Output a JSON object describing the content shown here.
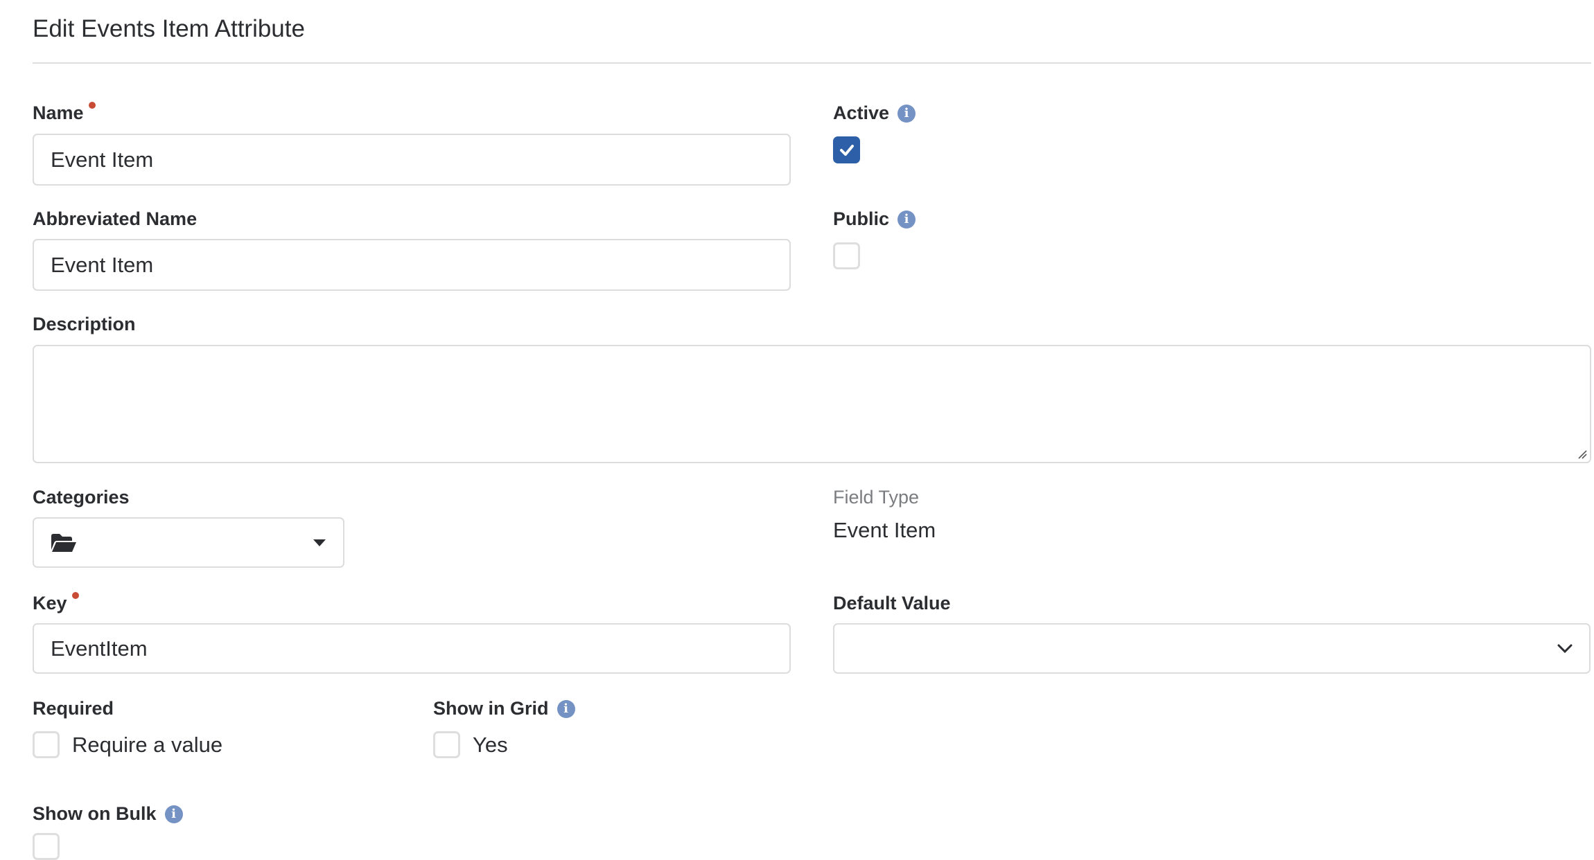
{
  "page": {
    "title": "Edit Events Item Attribute"
  },
  "form": {
    "name": {
      "label": "Name",
      "required": true,
      "value": "Event Item"
    },
    "active": {
      "label": "Active",
      "checked": true,
      "info_icon": "info-circle-icon"
    },
    "abbreviated_name": {
      "label": "Abbreviated Name",
      "value": "Event Item"
    },
    "public": {
      "label": "Public",
      "checked": false,
      "info_icon": "info-circle-icon"
    },
    "description": {
      "label": "Description",
      "value": ""
    },
    "categories": {
      "label": "Categories",
      "icon": "folder-open-icon",
      "value": ""
    },
    "field_type": {
      "label": "Field Type",
      "value": "Event Item"
    },
    "key": {
      "label": "Key",
      "required": true,
      "value": "EventItem"
    },
    "default_value": {
      "label": "Default Value",
      "selected": ""
    },
    "required": {
      "label": "Required",
      "option_label": "Require a value",
      "checked": false
    },
    "show_in_grid": {
      "label": "Show in Grid",
      "option_label": "Yes",
      "checked": false,
      "info_icon": "info-circle-icon"
    },
    "show_on_bulk": {
      "label": "Show on Bulk",
      "checked": false,
      "info_icon": "info-circle-icon"
    }
  },
  "colors": {
    "accent": "#2d5ea8",
    "info_icon": "#7592c4",
    "required_dot": "#c84b36",
    "border": "#dcdcdc",
    "text": "#2b2d31",
    "muted_text": "#7a7c80"
  }
}
